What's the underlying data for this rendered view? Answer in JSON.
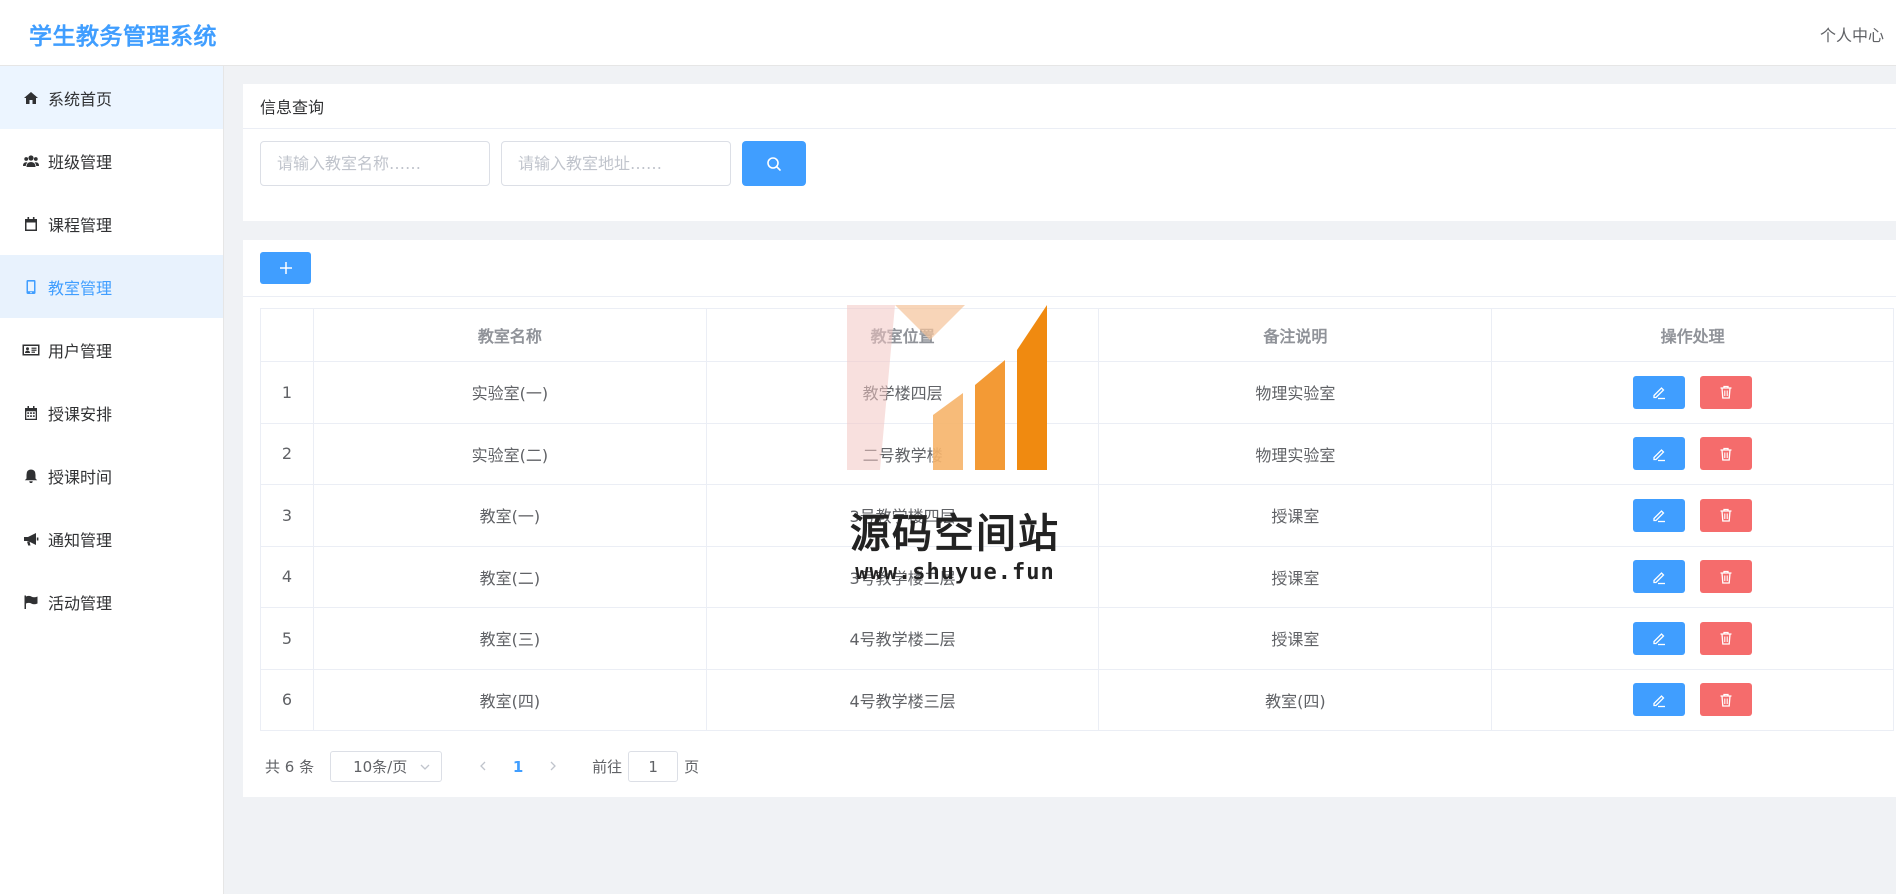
{
  "app": {
    "title": "学生教务管理系统",
    "user_center": "个人中心"
  },
  "sidebar": {
    "items": [
      {
        "label": "系统首页",
        "icon": "home-icon"
      },
      {
        "label": "班级管理",
        "icon": "users-icon"
      },
      {
        "label": "课程管理",
        "icon": "calendar-icon"
      },
      {
        "label": "教室管理",
        "icon": "tablet-icon"
      },
      {
        "label": "用户管理",
        "icon": "id-card-icon"
      },
      {
        "label": "授课安排",
        "icon": "calendar-grid-icon"
      },
      {
        "label": "授课时间",
        "icon": "bell-icon"
      },
      {
        "label": "通知管理",
        "icon": "bullhorn-icon"
      },
      {
        "label": "活动管理",
        "icon": "flag-icon"
      }
    ],
    "active_index": 3
  },
  "query": {
    "title": "信息查询",
    "name_placeholder": "请输入教室名称……",
    "address_placeholder": "请输入教室地址……"
  },
  "table": {
    "headers": [
      "",
      "教室名称",
      "教室位置",
      "备注说明",
      "操作处理"
    ],
    "rows": [
      {
        "index": "1",
        "name": "实验室(一)",
        "location": "教学楼四层",
        "remark": "物理实验室"
      },
      {
        "index": "2",
        "name": "实验室(二)",
        "location": "二号教学楼",
        "remark": "物理实验室"
      },
      {
        "index": "3",
        "name": "教室(一)",
        "location": "3号教学楼四层",
        "remark": "授课室"
      },
      {
        "index": "4",
        "name": "教室(二)",
        "location": "3号教学楼二层",
        "remark": "授课室"
      },
      {
        "index": "5",
        "name": "教室(三)",
        "location": "4号教学楼二层",
        "remark": "授课室"
      },
      {
        "index": "6",
        "name": "教室(四)",
        "location": "4号教学楼三层",
        "remark": "教室(四)"
      }
    ]
  },
  "pagination": {
    "total": "共 6 条",
    "page_size": "10条/页",
    "current_page": "1",
    "goto_label": "前往",
    "goto_value": "1",
    "page_label": "页"
  },
  "watermark": {
    "text": "源码空间站",
    "url": "www.shuyue.fun"
  },
  "colors": {
    "primary": "#409eff",
    "danger": "#f56c6c",
    "sidebar_active_bg": "#e8f2fd"
  }
}
